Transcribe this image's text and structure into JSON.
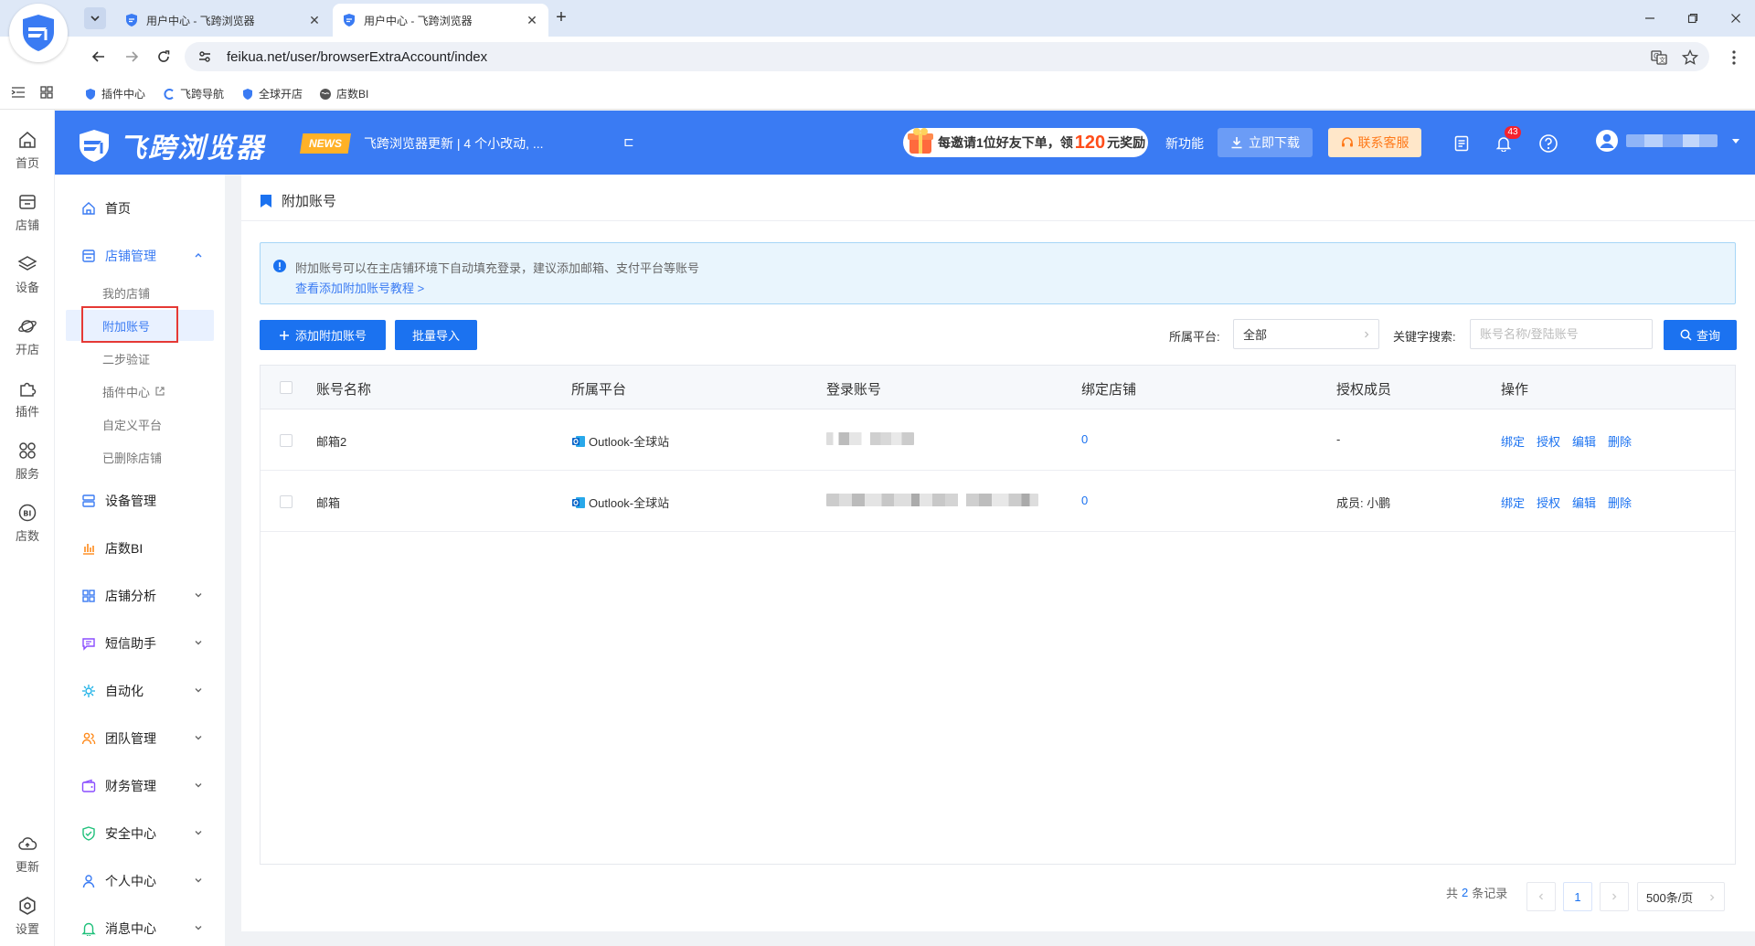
{
  "browser": {
    "tabs": [
      {
        "title": "用户中心 - 飞跨浏览器",
        "active": false
      },
      {
        "title": "用户中心 - 飞跨浏览器",
        "active": true
      }
    ],
    "url": "feikua.net/user/browserExtraAccount/index",
    "bookmarks": [
      {
        "label": "插件中心",
        "icon": "shield-icon"
      },
      {
        "label": "飞跨导航",
        "icon": "c-icon"
      },
      {
        "label": "全球开店",
        "icon": "shield-icon"
      },
      {
        "label": "店数BI",
        "icon": "globe-icon"
      }
    ]
  },
  "header": {
    "brand": "飞跨浏览器",
    "news_badge": "NEWS",
    "news_text": "飞跨浏览器更新 | 4 个小改动, ...",
    "news_more": "⊏",
    "promo": {
      "prefix": "每邀请1位好友下单，领",
      "amount": "120",
      "suffix": "元奖励"
    },
    "new_features": "新功能",
    "download": "立即下载",
    "service": "联系客服",
    "notification_count": "43",
    "accent_color": "#3a7bf3"
  },
  "rail": [
    {
      "label": "首页",
      "icon": "home-icon"
    },
    {
      "label": "店铺",
      "icon": "store-icon"
    },
    {
      "label": "设备",
      "icon": "layers-icon"
    },
    {
      "label": "开店",
      "icon": "planet-icon"
    },
    {
      "label": "插件",
      "icon": "puzzle-icon"
    },
    {
      "label": "服务",
      "icon": "grid-icon"
    },
    {
      "label": "店数",
      "icon": "bi-icon"
    },
    {
      "label": "更新",
      "icon": "cloud-icon"
    },
    {
      "label": "设置",
      "icon": "settings-icon"
    }
  ],
  "sidebar": {
    "home": "首页",
    "store_mgmt": "店铺管理",
    "sub": [
      "我的店铺",
      "附加账号",
      "二步验证",
      "插件中心",
      "自定义平台",
      "已删除店铺"
    ],
    "items": [
      "设备管理",
      "店数BI",
      "店铺分析",
      "短信助手",
      "自动化",
      "团队管理",
      "财务管理",
      "安全中心",
      "个人中心",
      "消息中心"
    ]
  },
  "page": {
    "title": "附加账号",
    "alert_text": "附加账号可以在主店铺环境下自动填充登录，建议添加邮箱、支付平台等账号",
    "alert_link": "查看添加附加账号教程 >",
    "add_button": "添加附加账号",
    "import_button": "批量导入",
    "platform_label": "所属平台:",
    "platform_value": "全部",
    "keyword_label": "关键字搜索:",
    "keyword_placeholder": "账号名称/登陆账号",
    "search_button": "查询"
  },
  "table": {
    "columns": [
      "账号名称",
      "所属平台",
      "登录账号",
      "绑定店铺",
      "授权成员",
      "操作"
    ],
    "rows": [
      {
        "name": "邮箱2",
        "platform": "Outlook-全球站",
        "bound": "0",
        "members": "-"
      },
      {
        "name": "邮箱",
        "platform": "Outlook-全球站",
        "bound": "0",
        "members": "成员: 小鹏"
      }
    ],
    "actions": [
      "绑定",
      "授权",
      "编辑",
      "删除"
    ]
  },
  "pagination": {
    "prefix": "共",
    "total": "2",
    "suffix": "条记录",
    "current_page": "1",
    "page_size": "500条/页"
  }
}
